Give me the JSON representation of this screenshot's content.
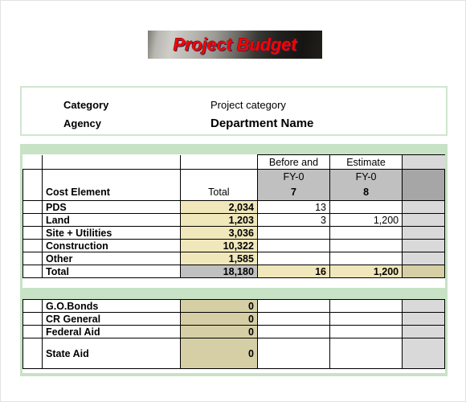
{
  "title": {
    "text": "Project Budget",
    "accent_color": "#ff0000"
  },
  "info": {
    "rows": [
      {
        "label": "Category",
        "value": "Project category"
      },
      {
        "label": "Agency",
        "value": "Department Name"
      }
    ]
  },
  "cost_table": {
    "group_headers": [
      "Before and",
      "Estimate"
    ],
    "column_headers": {
      "element": "Cost Element",
      "total": "Total",
      "fy_prefix_1": "FY-0",
      "fy_suffix_1": "7",
      "fy_prefix_2": "FY-0",
      "fy_suffix_2": "8"
    },
    "rows": [
      {
        "label": "PDS",
        "total": "2,034",
        "fy07": "13",
        "fy08": ""
      },
      {
        "label": "Land",
        "total": "1,203",
        "fy07": "3",
        "fy08": "1,200"
      },
      {
        "label": "Site + Utilities",
        "total": "3,036",
        "fy07": "",
        "fy08": ""
      },
      {
        "label": "Construction",
        "total": "10,322",
        "fy07": "",
        "fy08": ""
      },
      {
        "label": "Other",
        "total": "1,585",
        "fy07": "",
        "fy08": ""
      }
    ],
    "total_row": {
      "label": "Total",
      "total": "18,180",
      "fy07": "16",
      "fy08": "1,200"
    }
  },
  "funding_table": {
    "rows": [
      {
        "label": "G.O.Bonds",
        "total": "0",
        "fy07": "",
        "fy08": ""
      },
      {
        "label": "CR General",
        "total": "0",
        "fy07": "",
        "fy08": ""
      },
      {
        "label": "Federal Aid",
        "total": "0",
        "fy07": "",
        "fy08": ""
      },
      {
        "label": "State Aid",
        "total": "0",
        "fy07": "",
        "fy08": ""
      }
    ]
  },
  "colors": {
    "band_green": "#c7e2c5",
    "cell_cream": "#f0e7bb",
    "cell_tan": "#d6cfa6",
    "cell_gray": "#c0c0c0",
    "cell_gray_light": "#d9d9d9",
    "cell_gray_dark": "#a6a6a6"
  }
}
